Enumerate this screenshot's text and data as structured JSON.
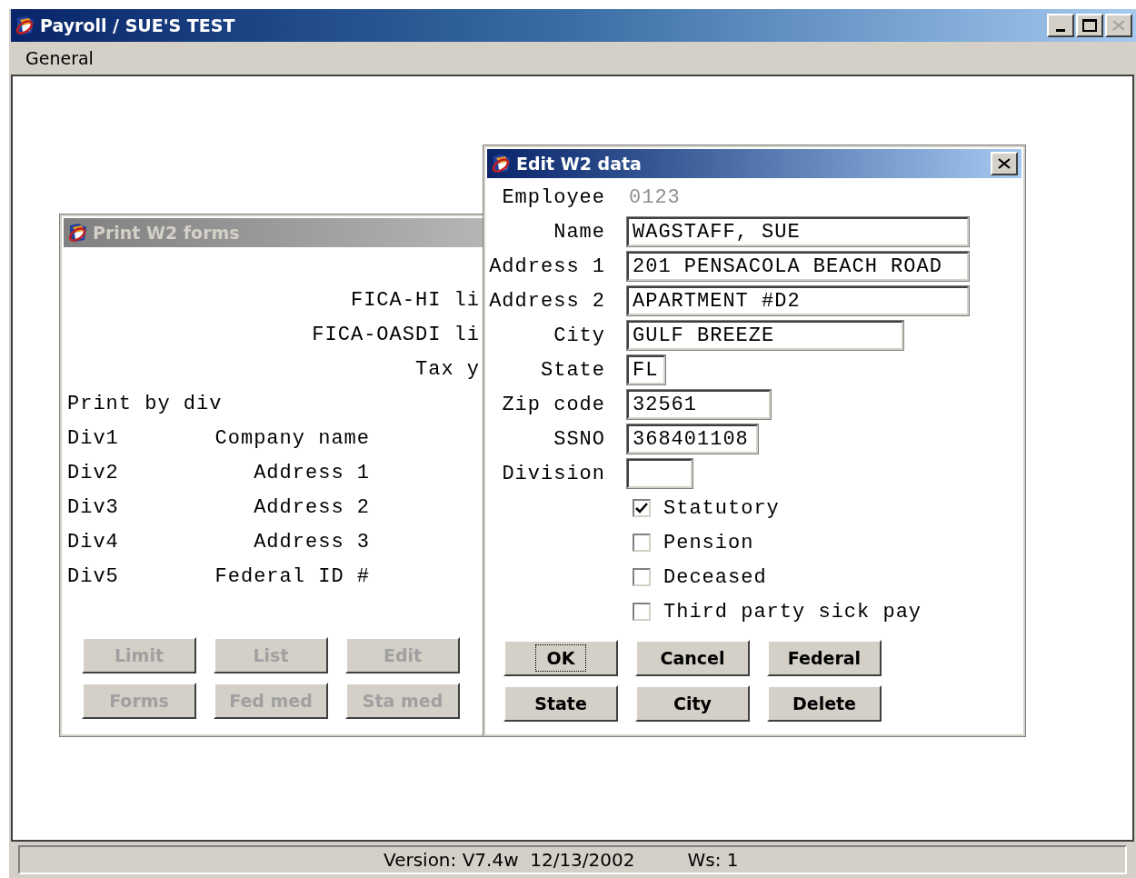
{
  "window": {
    "title": "Payroll / SUE'S TEST"
  },
  "menu": [
    {
      "label": "General"
    }
  ],
  "print_w2_window": {
    "title": "Print W2 forms",
    "active": false,
    "limits": [
      {
        "label": "FICA-HI li"
      },
      {
        "label": "FICA-OASDI li"
      },
      {
        "label": "Tax y"
      }
    ],
    "print_by": "Print by div",
    "divisions": [
      {
        "div": "Div1",
        "label": "Company name"
      },
      {
        "div": "Div2",
        "label": "Address 1"
      },
      {
        "div": "Div3",
        "label": "Address 2"
      },
      {
        "div": "Div4",
        "label": "Address 3"
      },
      {
        "div": "Div5",
        "label": "Federal ID #"
      }
    ],
    "buttons": [
      {
        "label": "Limit",
        "disabled": true
      },
      {
        "label": "List",
        "disabled": true
      },
      {
        "label": "Edit",
        "disabled": true
      },
      {
        "label": "Forms",
        "disabled": true
      },
      {
        "label": "Fed med",
        "disabled": true
      },
      {
        "label": "Sta med",
        "disabled": true
      }
    ]
  },
  "edit_w2_window": {
    "title": "Edit W2 data",
    "active": true,
    "employee": {
      "label": "Employee",
      "value": "0123"
    },
    "fields": [
      {
        "label": "Name",
        "value": "WAGSTAFF, SUE"
      },
      {
        "label": "Address 1",
        "value": "201 PENSACOLA BEACH ROAD"
      },
      {
        "label": "Address 2",
        "value": "APARTMENT #D2"
      },
      {
        "label": "City",
        "value": "GULF BREEZE"
      },
      {
        "label": "State",
        "value": "FL"
      },
      {
        "label": "Zip code",
        "value": "32561"
      },
      {
        "label": "SSNO",
        "value": "368401108"
      },
      {
        "label": "Division"
      }
    ],
    "checkboxes": [
      {
        "label": "Statutory",
        "checked": true
      },
      {
        "label": "Pension",
        "checked": false
      },
      {
        "label": "Deceased",
        "checked": false
      },
      {
        "label": "Third party sick pay",
        "checked": false
      }
    ],
    "buttons": [
      {
        "label": "OK",
        "focused": true
      },
      {
        "label": "Cancel",
        "focused": false
      },
      {
        "label": "Federal",
        "focused": false
      },
      {
        "label": "State",
        "focused": false
      },
      {
        "label": "City",
        "focused": false
      },
      {
        "label": "Delete",
        "focused": false
      }
    ]
  },
  "status_bar": {
    "version": "Version: V7.4w  12/13/2002",
    "ws": "Ws: 1"
  }
}
